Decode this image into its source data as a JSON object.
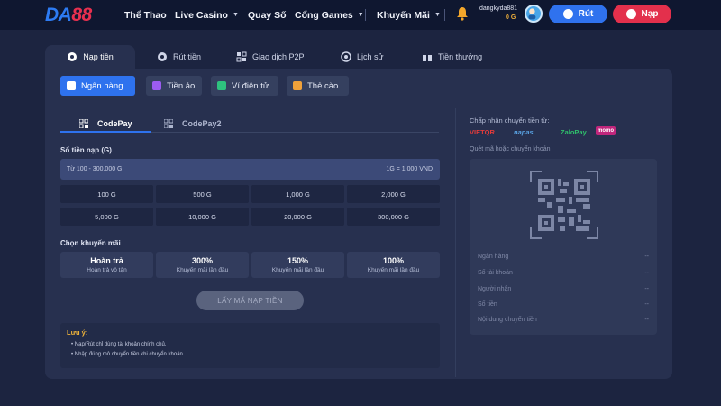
{
  "brand": {
    "part1": "DA",
    "part2": "88"
  },
  "nav": [
    {
      "label": "Thể Thao",
      "chevron": false
    },
    {
      "label": "Live Casino",
      "chevron": true
    },
    {
      "label": "Quay Số",
      "chevron": false
    },
    {
      "label": "Cổng Games",
      "chevron": true
    },
    {
      "label": "Khuyến Mãi",
      "chevron": true
    }
  ],
  "user": {
    "name": "dangkyda881",
    "balance": "0 G"
  },
  "actions": {
    "withdraw": "Rút",
    "deposit": "Nạp"
  },
  "tabs": [
    "Nạp tiền",
    "Rút tiền",
    "Giao dịch P2P",
    "Lịch sử",
    "Tiền thưởng"
  ],
  "methods": [
    "Ngân hàng",
    "Tiền ảo",
    "Ví điện tử",
    "Thẻ cào"
  ],
  "codepay": [
    "CodePay",
    "CodePay2"
  ],
  "amount": {
    "label": "Số tiền nạp (G)",
    "placeholder": "Từ 100 - 300,000 G",
    "rate": "1G = 1,000 VND",
    "options": [
      "100 G",
      "500 G",
      "1,000 G",
      "2,000 G",
      "5,000 G",
      "10,000 G",
      "20,000 G",
      "300,000 G"
    ]
  },
  "promo": {
    "label": "Chọn khuyến mãi",
    "items": [
      {
        "title": "Hoàn trả",
        "sub": "Hoàn trả vô tận"
      },
      {
        "title": "300%",
        "sub": "Khuyến mãi lần đầu"
      },
      {
        "title": "150%",
        "sub": "Khuyến mãi lần đầu"
      },
      {
        "title": "100%",
        "sub": "Khuyến mãi lần đầu"
      }
    ]
  },
  "get_code": "LẤY MÃ NẠP TIỀN",
  "note": {
    "title": "Lưu ý:",
    "lines": [
      "Nạp/Rút chỉ dùng tài khoản chính chủ.",
      "Nhập đúng mô chuyển tiền khi chuyển khoản."
    ]
  },
  "accept_label": "Chấp nhận chuyển tiền từ:",
  "banks": [
    {
      "name": "VIETQR",
      "color": "#e23b3b"
    },
    {
      "name": "napas",
      "color": "#5aa4e6"
    },
    {
      "name": "ZaloPay",
      "color": "#2fbf6b"
    },
    {
      "name": "momo",
      "color": "#c0267c"
    }
  ],
  "scan_label": "Quét mã hoặc chuyển khoản",
  "details": [
    {
      "label": "Ngân hàng",
      "value": "--"
    },
    {
      "label": "Số tài khoản",
      "value": "--"
    },
    {
      "label": "Người nhận",
      "value": "--"
    },
    {
      "label": "Số tiền",
      "value": "--"
    },
    {
      "label": "Nội dung chuyển tiền",
      "value": "--"
    }
  ],
  "colors": {
    "primary": "#2e72ee",
    "danger": "#e3304c",
    "bg": "#1c2440",
    "panel": "#27304f",
    "warning": "#f0b43a"
  }
}
